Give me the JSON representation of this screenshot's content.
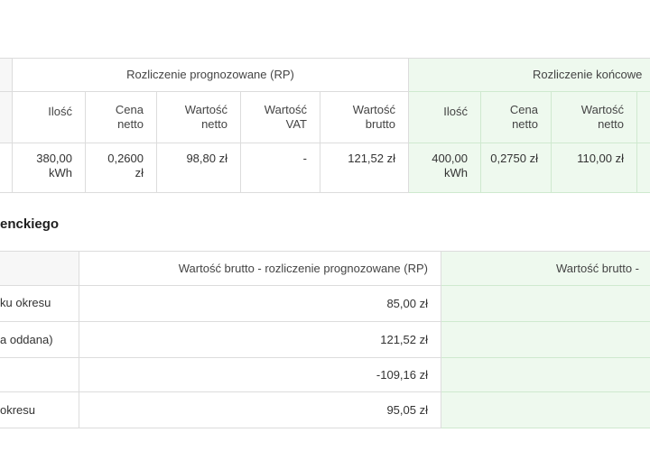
{
  "table1": {
    "rp_title": "Rozliczenie prognozowane (RP)",
    "rk_title": "Rozliczenie końcowe",
    "headers": {
      "ilosc": "Ilość",
      "cena_l1": "Cena",
      "cena_l2": "netto",
      "wn_l1": "Wartość",
      "wn_l2": "netto",
      "vat_l1": "Wartość",
      "vat_l2": "VAT",
      "wb_l1": "Wartość",
      "wb_l2": "brutto",
      "ilosc2": "Ilość",
      "cena2_l1": "Cena",
      "cena2_l2": "netto",
      "wn2_l1": "Wartość",
      "wn2_l2": "netto"
    },
    "row": {
      "ilosc_l1": "380,00",
      "ilosc_l2": "kWh",
      "cena_l1": "0,2600",
      "cena_l2": "zł",
      "wartosc_netto": "98,80 zł",
      "wartosc_vat": "-",
      "wartosc_brutto": "121,52 zł",
      "ilosc2_l1": "400,00",
      "ilosc2_l2": "kWh",
      "cena2": "0,2750 zł",
      "wartosc_netto2": "110,00 zł"
    }
  },
  "section2": {
    "title": "enckiego",
    "col_rp": "Wartość brutto - rozliczenie prognozowane (RP)",
    "col_rk": "Wartość brutto -",
    "rows": [
      {
        "label": "ku okresu",
        "value": "85,00 zł"
      },
      {
        "label": "a oddana)",
        "value": "121,52 zł"
      },
      {
        "label": "",
        "value": "-109,16 zł"
      },
      {
        "label": "okresu",
        "value": "95,05 zł"
      }
    ]
  },
  "colors": {
    "green_bg": "#eef9ee",
    "border": "#dcdcdc"
  }
}
